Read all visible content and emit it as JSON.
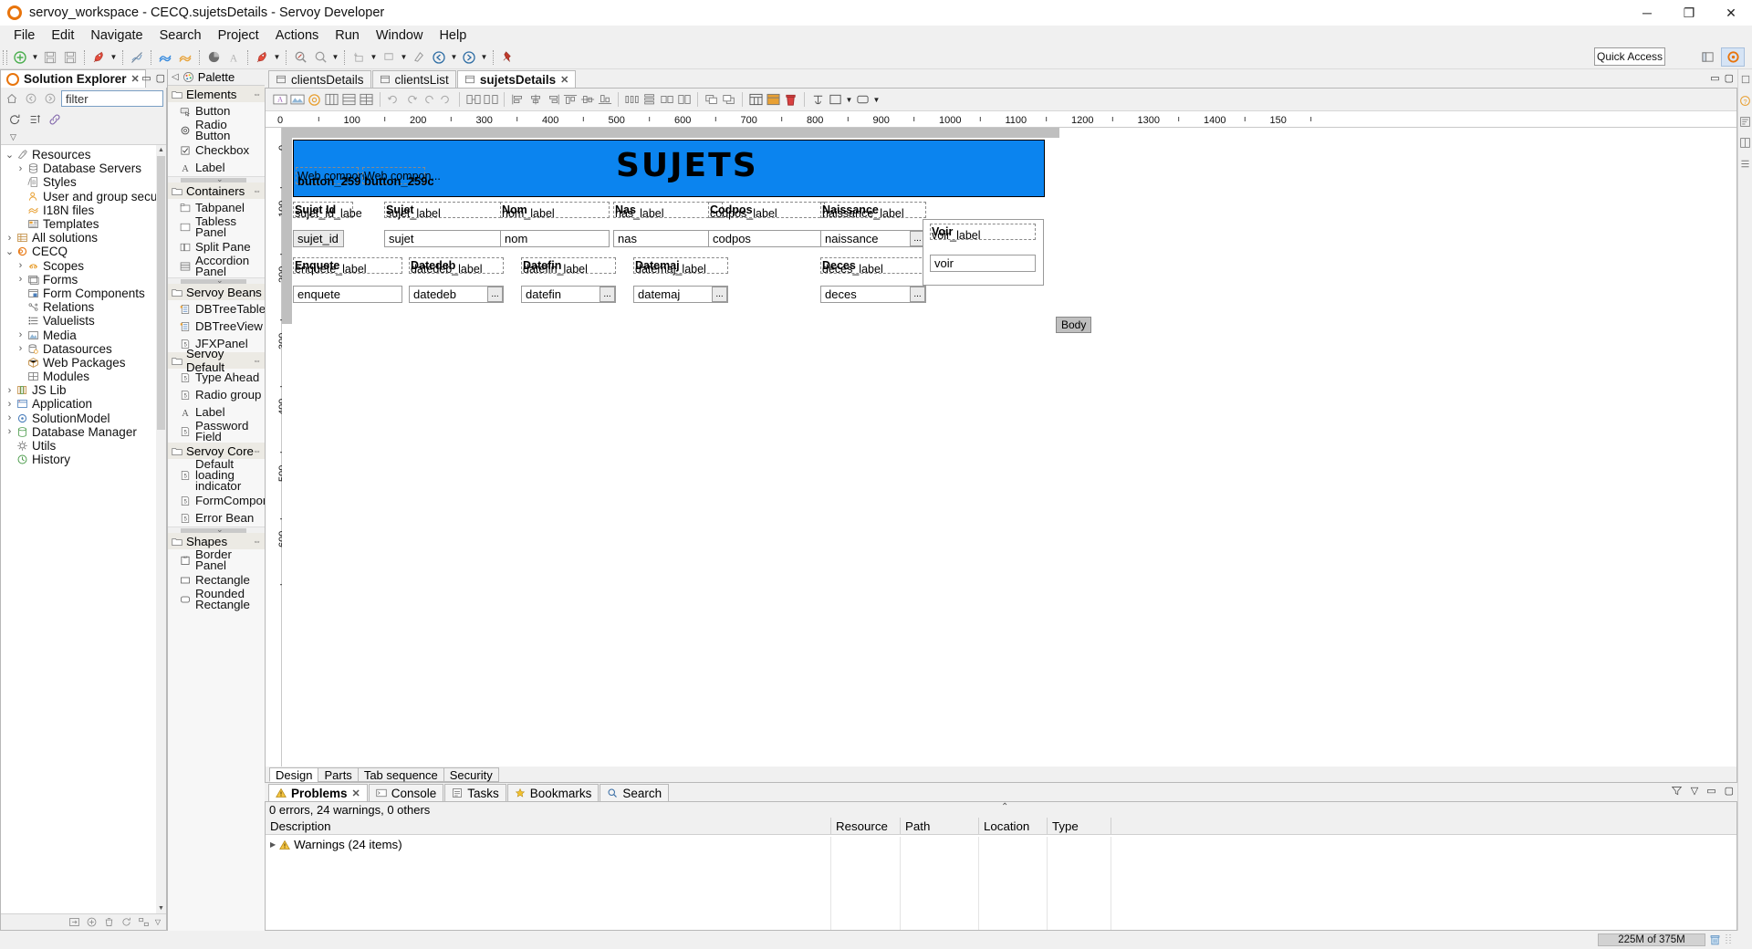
{
  "window": {
    "title": "servoy_workspace - CECQ.sujetsDetails - Servoy Developer",
    "minimize": "─",
    "maximize": "❐",
    "close": "✕"
  },
  "menu": [
    "File",
    "Edit",
    "Navigate",
    "Search",
    "Project",
    "Actions",
    "Run",
    "Window",
    "Help"
  ],
  "toolbar": {
    "quick_access": "Quick Access"
  },
  "solution_explorer": {
    "tab_label": "Solution Explorer",
    "filter_placeholder": "filter",
    "tree": [
      {
        "label": "Resources",
        "depth": 0,
        "twisty": "down",
        "icon": "resources-icon"
      },
      {
        "label": "Database Servers",
        "depth": 1,
        "twisty": "right",
        "icon": "database-icon"
      },
      {
        "label": "Styles",
        "depth": 1,
        "twisty": "",
        "icon": "styles-icon"
      },
      {
        "label": "User and group security",
        "depth": 1,
        "twisty": "",
        "icon": "security-icon"
      },
      {
        "label": "I18N files",
        "depth": 1,
        "twisty": "",
        "icon": "i18n-icon"
      },
      {
        "label": "Templates",
        "depth": 1,
        "twisty": "",
        "icon": "templates-icon"
      },
      {
        "label": "All solutions",
        "depth": 0,
        "twisty": "right",
        "icon": "all-solutions-icon"
      },
      {
        "label": "CECQ",
        "depth": 0,
        "twisty": "down",
        "icon": "solution-icon"
      },
      {
        "label": "Scopes",
        "depth": 1,
        "twisty": "right",
        "icon": "scopes-icon"
      },
      {
        "label": "Forms",
        "depth": 1,
        "twisty": "right",
        "icon": "forms-icon"
      },
      {
        "label": "Form Components",
        "depth": 1,
        "twisty": "",
        "icon": "form-components-icon"
      },
      {
        "label": "Relations",
        "depth": 1,
        "twisty": "",
        "icon": "relations-icon"
      },
      {
        "label": "Valuelists",
        "depth": 1,
        "twisty": "",
        "icon": "valuelists-icon"
      },
      {
        "label": "Media",
        "depth": 1,
        "twisty": "right",
        "icon": "media-icon"
      },
      {
        "label": "Datasources",
        "depth": 1,
        "twisty": "right",
        "icon": "datasources-icon"
      },
      {
        "label": "Web Packages",
        "depth": 1,
        "twisty": "",
        "icon": "web-packages-icon"
      },
      {
        "label": "Modules",
        "depth": 1,
        "twisty": "",
        "icon": "modules-icon"
      },
      {
        "label": "JS Lib",
        "depth": 0,
        "twisty": "right",
        "icon": "js-lib-icon"
      },
      {
        "label": "Application",
        "depth": 0,
        "twisty": "right",
        "icon": "application-icon"
      },
      {
        "label": "SolutionModel",
        "depth": 0,
        "twisty": "right",
        "icon": "solution-model-icon"
      },
      {
        "label": "Database Manager",
        "depth": 0,
        "twisty": "right",
        "icon": "database-manager-icon"
      },
      {
        "label": "Utils",
        "depth": 0,
        "twisty": "",
        "icon": "utils-icon"
      },
      {
        "label": "History",
        "depth": 0,
        "twisty": "",
        "icon": "history-icon"
      }
    ]
  },
  "palette": {
    "title": "Palette",
    "groups": [
      {
        "name": "Elements",
        "items": [
          {
            "label": "Button",
            "icon": "button-icon"
          },
          {
            "label": "Radio Button",
            "icon": "radio-icon"
          },
          {
            "label": "Checkbox",
            "icon": "checkbox-icon"
          },
          {
            "label": "Label",
            "icon": "label-icon"
          }
        ]
      },
      {
        "name": "Containers",
        "items": [
          {
            "label": "Tabpanel",
            "icon": "tabpanel-icon"
          },
          {
            "label": "Tabless Panel",
            "icon": "tabless-panel-icon"
          },
          {
            "label": "Split Pane",
            "icon": "split-pane-icon"
          },
          {
            "label": "Accordion Panel",
            "icon": "accordion-panel-icon"
          }
        ]
      },
      {
        "name": "Servoy Beans",
        "items": [
          {
            "label": "DBTreeTableView",
            "icon": "dbtreetableview-icon"
          },
          {
            "label": "DBTreeView",
            "icon": "dbtreeview-icon"
          },
          {
            "label": "JFXPanel",
            "icon": "jfxpanel-icon"
          }
        ]
      },
      {
        "name": "Servoy Default",
        "items": [
          {
            "label": "Type Ahead",
            "icon": "type-ahead-icon"
          },
          {
            "label": "Radio group",
            "icon": "radio-group-icon"
          },
          {
            "label": "Label",
            "icon": "label-icon"
          },
          {
            "label": "Password Field",
            "icon": "password-field-icon"
          }
        ]
      },
      {
        "name": "Servoy Core",
        "items": [
          {
            "label": "Default loading indicator",
            "icon": "loading-indicator-icon"
          },
          {
            "label": "FormCompon...",
            "icon": "form-component-icon"
          },
          {
            "label": "Error Bean",
            "icon": "error-bean-icon"
          }
        ]
      },
      {
        "name": "Shapes",
        "items": [
          {
            "label": "Border Panel",
            "icon": "border-panel-icon"
          },
          {
            "label": "Rectangle",
            "icon": "rectangle-icon"
          },
          {
            "label": "Rounded Rectangle",
            "icon": "rounded-rectangle-icon"
          }
        ]
      }
    ]
  },
  "editor": {
    "tabs": [
      {
        "label": "clientsDetails",
        "active": false
      },
      {
        "label": "clientsList",
        "active": false
      },
      {
        "label": "sujetsDetails",
        "active": true
      }
    ],
    "bottom_tabs": [
      {
        "label": "Design",
        "active": true
      },
      {
        "label": "Parts",
        "active": false
      },
      {
        "label": "Tab sequence",
        "active": false
      },
      {
        "label": "Security",
        "active": false
      }
    ],
    "ruler_h": [
      "0",
      "100",
      "200",
      "300",
      "400",
      "500",
      "600",
      "700",
      "800",
      "900",
      "1000",
      "1100",
      "1200",
      "1300",
      "1400",
      "150"
    ],
    "ruler_v": [
      "0",
      "100",
      "200",
      "300",
      "400",
      "500",
      "600"
    ],
    "body_part_label": "Body",
    "form": {
      "title": "SUJETS",
      "header_buttons": [
        {
          "overlay": "Web compon...",
          "under": "button_259"
        },
        {
          "overlay": "Web compon...",
          "under": "button_259c"
        }
      ],
      "rows": [
        {
          "fields": [
            {
              "label_top": "Sujet Id",
              "label_bottom": "sujet_id_labe",
              "value": "sujet_id",
              "grey": true,
              "dots": false
            },
            {
              "label_top": "Sujet",
              "label_bottom": "sujet_label",
              "value": "sujet",
              "grey": false,
              "dots": false
            },
            {
              "label_top": "Nom",
              "label_bottom": "nom_label",
              "value": "nom",
              "grey": false,
              "dots": false
            },
            {
              "label_top": "Nas",
              "label_bottom": "nas_label",
              "value": "nas",
              "grey": false,
              "dots": false
            },
            {
              "label_top": "Codpos",
              "label_bottom": "codpos_label",
              "value": "codpos",
              "grey": false,
              "dots": false
            },
            {
              "label_top": "Naissance",
              "label_bottom": "naissance_label",
              "value": "naissance",
              "grey": false,
              "dots": true
            }
          ]
        },
        {
          "fields": [
            {
              "label_top": "Enquete",
              "label_bottom": "enquete_label",
              "value": "enquete",
              "grey": false,
              "dots": false
            },
            {
              "label_top": "Datedeb",
              "label_bottom": "datedeb_label",
              "value": "datedeb",
              "grey": false,
              "dots": true
            },
            {
              "label_top": "Datefin",
              "label_bottom": "datefin_label",
              "value": "datefin",
              "grey": false,
              "dots": true
            },
            {
              "label_top": "Datemaj",
              "label_bottom": "datemaj_label",
              "value": "datemaj",
              "grey": false,
              "dots": true
            },
            {
              "label_top": "Deces",
              "label_bottom": "deces_label",
              "value": "deces",
              "grey": false,
              "dots": true
            }
          ]
        }
      ],
      "side_panel": {
        "label_top": "Voir",
        "label_bottom": "voir_label",
        "value": "voir"
      }
    }
  },
  "problems": {
    "tabs": [
      {
        "label": "Problems",
        "active": true,
        "icon": "warning-icon"
      },
      {
        "label": "Console",
        "active": false,
        "icon": "console-icon"
      },
      {
        "label": "Tasks",
        "active": false,
        "icon": "tasks-icon"
      },
      {
        "label": "Bookmarks",
        "active": false,
        "icon": "bookmark-icon"
      },
      {
        "label": "Search",
        "active": false,
        "icon": "search-icon"
      }
    ],
    "summary": "0 errors, 24 warnings, 0 others",
    "columns": [
      "Description",
      "Resource",
      "Path",
      "Location",
      "Type"
    ],
    "rows": [
      {
        "description": "Warnings (24 items)",
        "resource": "",
        "path": "",
        "location": "",
        "type": ""
      }
    ]
  },
  "status": {
    "memory": "225M of 375M"
  },
  "colors": {
    "accent_blue": "#0b84ef",
    "brand_orange": "#e8740c",
    "panel_bg": "#f0f0f0",
    "tab_active": "#ffffff"
  }
}
